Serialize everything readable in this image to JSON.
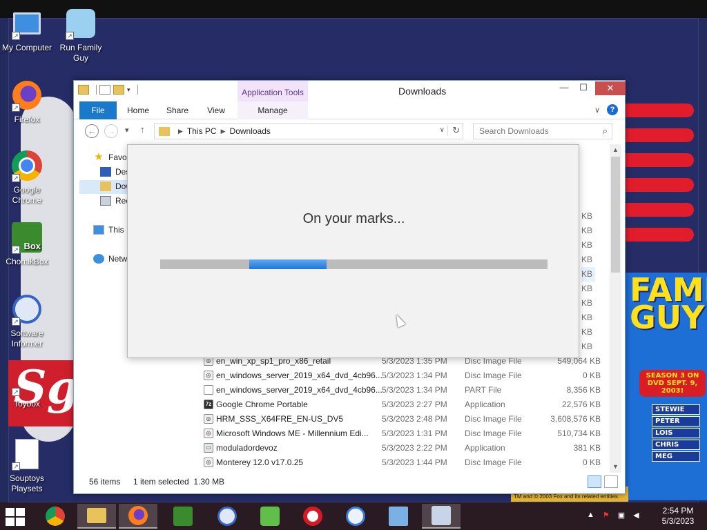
{
  "desktop": {
    "icons": [
      {
        "label": "My Computer",
        "icon": "computer-icon"
      },
      {
        "label": "Run Family Guy",
        "icon": "family-guy-icon"
      },
      {
        "label": "Firefox",
        "icon": "firefox-icon"
      },
      {
        "label": "Google Chrome",
        "icon": "chrome-icon"
      },
      {
        "label": "ChomikBox",
        "icon": "chomikbox-icon"
      },
      {
        "label": "Software Informer",
        "icon": "software-informer-icon"
      },
      {
        "label": "Toybox",
        "icon": "toybox-icon"
      },
      {
        "label": "Souptoys Playsets",
        "icon": "souptoys-icon"
      }
    ],
    "wallpaper": {
      "logo_text": "Sg",
      "poster_title": "FAMILY GUY",
      "season_text": "SEASON 3 ON DVD SEPT. 9, 2003!",
      "names": [
        "STEWIE",
        "PETER",
        "LOIS",
        "CHRIS",
        "MEG"
      ],
      "copyright": "TM and © 2003 Fox and its related entities."
    }
  },
  "explorer": {
    "title": "Downloads",
    "app_tools_label": "Application Tools",
    "tabs": {
      "file": "File",
      "home": "Home",
      "share": "Share",
      "view": "View",
      "manage": "Manage"
    },
    "window_buttons": {
      "minimize": "—",
      "maximize": "☐",
      "close": "✕"
    },
    "address": {
      "root": "This PC",
      "current": "Downloads"
    },
    "search_placeholder": "Search Downloads",
    "nav_pane": {
      "favorites": "Favorites",
      "desktop": "Desktop",
      "downloads": "Downloads",
      "recent": "Recent places",
      "this_pc": "This PC",
      "network": "Network"
    },
    "size_fragments": [
      "KB",
      "KB",
      "KB",
      "KB",
      "KB",
      "KB",
      "KB",
      "KB",
      "KB",
      "KB"
    ],
    "files": [
      {
        "name": "en_win_xp_sp1_pro_x86_retail",
        "date": "5/3/2023 1:35 PM",
        "type": "Disc Image File",
        "size": "549,064 KB",
        "icon": "disc-image-icon"
      },
      {
        "name": "en_windows_server_2019_x64_dvd_4cb96...",
        "date": "5/3/2023 1:34 PM",
        "type": "Disc Image File",
        "size": "0 KB",
        "icon": "disc-image-icon"
      },
      {
        "name": "en_windows_server_2019_x64_dvd_4cb96...",
        "date": "5/3/2023 1:34 PM",
        "type": "PART File",
        "size": "8,356 KB",
        "icon": "blank-file-icon"
      },
      {
        "name": "Google Chrome Portable",
        "date": "5/3/2023 2:27 PM",
        "type": "Application",
        "size": "22,576 KB",
        "icon": "7z-app-icon"
      },
      {
        "name": "HRM_SSS_X64FRE_EN-US_DV5",
        "date": "5/3/2023 2:48 PM",
        "type": "Disc Image File",
        "size": "3,608,576 KB",
        "icon": "disc-image-icon"
      },
      {
        "name": "Microsoft Windows ME - Millennium Edi...",
        "date": "5/3/2023 1:31 PM",
        "type": "Disc Image File",
        "size": "510,734 KB",
        "icon": "disc-image-icon"
      },
      {
        "name": "moduladordevoz",
        "date": "5/3/2023 2:22 PM",
        "type": "Application",
        "size": "381 KB",
        "icon": "application-icon"
      },
      {
        "name": "Monterey 12.0 v17.0.25",
        "date": "5/3/2023 1:44 PM",
        "type": "Disc Image File",
        "size": "0 KB",
        "icon": "disc-image-icon"
      }
    ],
    "status": {
      "items": "56 items",
      "selected": "1 item selected  1.30 MB"
    }
  },
  "dialog": {
    "message": "On your marks...",
    "progress_start": 0.23,
    "progress_end": 0.43
  },
  "taskbar": {
    "clock_time": "2:54 PM",
    "clock_date": "5/3/2023"
  }
}
